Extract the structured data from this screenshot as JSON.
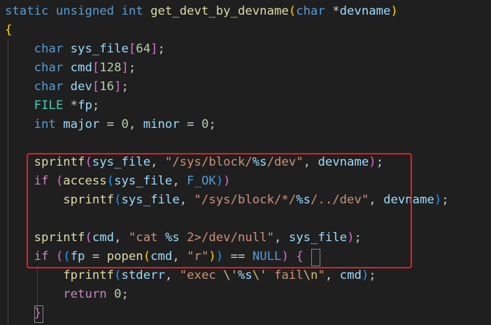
{
  "editor": {
    "theme_colors": {
      "background": "#1f1f1f",
      "keyword": "#569cd6",
      "control_keyword": "#c586c0",
      "function": "#dcdcaa",
      "variable": "#9cdcfe",
      "string": "#ce9178",
      "number": "#b5cea8",
      "type": "#4ec9b0",
      "highlight_box": "#e81e1e"
    },
    "lines": [
      [
        {
          "t": "static unsigned int ",
          "c": "keyword"
        },
        {
          "t": "get_devt_by_devname",
          "c": "func"
        },
        {
          "t": "(",
          "c": "brace1"
        },
        {
          "t": "char ",
          "c": "keyword"
        },
        {
          "t": "*",
          "c": "punc"
        },
        {
          "t": "devname",
          "c": "var"
        },
        {
          "t": ")",
          "c": "brace1"
        }
      ],
      [
        {
          "t": "{",
          "c": "brace1"
        }
      ],
      [
        {
          "t": "    ",
          "c": "punc"
        },
        {
          "t": "char ",
          "c": "keyword"
        },
        {
          "t": "sys_file",
          "c": "var"
        },
        {
          "t": "[",
          "c": "paren2"
        },
        {
          "t": "64",
          "c": "num"
        },
        {
          "t": "]",
          "c": "paren2"
        },
        {
          "t": ";",
          "c": "punc"
        }
      ],
      [
        {
          "t": "    ",
          "c": "punc"
        },
        {
          "t": "char ",
          "c": "keyword"
        },
        {
          "t": "cmd",
          "c": "var"
        },
        {
          "t": "[",
          "c": "paren2"
        },
        {
          "t": "128",
          "c": "num"
        },
        {
          "t": "]",
          "c": "paren2"
        },
        {
          "t": ";",
          "c": "punc"
        }
      ],
      [
        {
          "t": "    ",
          "c": "punc"
        },
        {
          "t": "char ",
          "c": "keyword"
        },
        {
          "t": "dev",
          "c": "var"
        },
        {
          "t": "[",
          "c": "paren2"
        },
        {
          "t": "16",
          "c": "num"
        },
        {
          "t": "]",
          "c": "paren2"
        },
        {
          "t": ";",
          "c": "punc"
        }
      ],
      [
        {
          "t": "    ",
          "c": "punc"
        },
        {
          "t": "FILE ",
          "c": "type"
        },
        {
          "t": "*",
          "c": "punc"
        },
        {
          "t": "fp",
          "c": "var"
        },
        {
          "t": ";",
          "c": "punc"
        }
      ],
      [
        {
          "t": "    ",
          "c": "punc"
        },
        {
          "t": "int ",
          "c": "keyword"
        },
        {
          "t": "major",
          "c": "var"
        },
        {
          "t": " = ",
          "c": "punc"
        },
        {
          "t": "0",
          "c": "num"
        },
        {
          "t": ", ",
          "c": "punc"
        },
        {
          "t": "minor",
          "c": "var"
        },
        {
          "t": " = ",
          "c": "punc"
        },
        {
          "t": "0",
          "c": "num"
        },
        {
          "t": ";",
          "c": "punc"
        }
      ],
      [],
      [
        {
          "t": "    ",
          "c": "punc"
        },
        {
          "t": "sprintf",
          "c": "func"
        },
        {
          "t": "(",
          "c": "paren2"
        },
        {
          "t": "sys_file",
          "c": "var"
        },
        {
          "t": ", ",
          "c": "punc"
        },
        {
          "t": "\"/sys/block/",
          "c": "str"
        },
        {
          "t": "%s",
          "c": "var"
        },
        {
          "t": "/dev\"",
          "c": "str"
        },
        {
          "t": ", ",
          "c": "punc"
        },
        {
          "t": "devname",
          "c": "var"
        },
        {
          "t": ")",
          "c": "paren2"
        },
        {
          "t": ";",
          "c": "punc"
        }
      ],
      [
        {
          "t": "    ",
          "c": "punc"
        },
        {
          "t": "if ",
          "c": "control"
        },
        {
          "t": "(",
          "c": "paren2"
        },
        {
          "t": "access",
          "c": "func"
        },
        {
          "t": "(",
          "c": "paren3"
        },
        {
          "t": "sys_file",
          "c": "var"
        },
        {
          "t": ", ",
          "c": "punc"
        },
        {
          "t": "F_OK",
          "c": "keyword"
        },
        {
          "t": ")",
          "c": "paren3"
        },
        {
          "t": ")",
          "c": "paren2"
        }
      ],
      [
        {
          "t": "        ",
          "c": "punc"
        },
        {
          "t": "sprintf",
          "c": "func"
        },
        {
          "t": "(",
          "c": "paren3"
        },
        {
          "t": "sys_file",
          "c": "var"
        },
        {
          "t": ", ",
          "c": "punc"
        },
        {
          "t": "\"/sys/block/*/",
          "c": "str"
        },
        {
          "t": "%s",
          "c": "var"
        },
        {
          "t": "/../dev\"",
          "c": "str"
        },
        {
          "t": ", ",
          "c": "punc"
        },
        {
          "t": "devname",
          "c": "var"
        },
        {
          "t": ")",
          "c": "paren3"
        },
        {
          "t": ";",
          "c": "punc"
        }
      ],
      [],
      [
        {
          "t": "    ",
          "c": "punc"
        },
        {
          "t": "sprintf",
          "c": "func"
        },
        {
          "t": "(",
          "c": "paren2"
        },
        {
          "t": "cmd",
          "c": "var"
        },
        {
          "t": ", ",
          "c": "punc"
        },
        {
          "t": "\"cat ",
          "c": "str"
        },
        {
          "t": "%s",
          "c": "var"
        },
        {
          "t": " 2>/dev/null\"",
          "c": "str"
        },
        {
          "t": ", ",
          "c": "punc"
        },
        {
          "t": "sys_file",
          "c": "var"
        },
        {
          "t": ")",
          "c": "paren2"
        },
        {
          "t": ";",
          "c": "punc"
        }
      ],
      [
        {
          "t": "    ",
          "c": "punc"
        },
        {
          "t": "if ",
          "c": "control"
        },
        {
          "t": "(",
          "c": "paren2"
        },
        {
          "t": "(",
          "c": "paren3"
        },
        {
          "t": "fp",
          "c": "var"
        },
        {
          "t": " = ",
          "c": "punc"
        },
        {
          "t": "popen",
          "c": "func"
        },
        {
          "t": "(",
          "c": "brace1"
        },
        {
          "t": "cmd",
          "c": "var"
        },
        {
          "t": ", ",
          "c": "punc"
        },
        {
          "t": "\"r\"",
          "c": "str"
        },
        {
          "t": ")",
          "c": "brace1"
        },
        {
          "t": ")",
          "c": "paren3"
        },
        {
          "t": " == ",
          "c": "punc"
        },
        {
          "t": "NULL",
          "c": "keyword"
        },
        {
          "t": ")",
          "c": "paren2"
        },
        {
          "t": " ",
          "c": "punc"
        },
        {
          "t": "{",
          "c": "paren2"
        }
      ],
      [
        {
          "t": "        ",
          "c": "punc"
        },
        {
          "t": "fprintf",
          "c": "func"
        },
        {
          "t": "(",
          "c": "paren3"
        },
        {
          "t": "stderr",
          "c": "var"
        },
        {
          "t": ", ",
          "c": "punc"
        },
        {
          "t": "\"exec ",
          "c": "str"
        },
        {
          "t": "\\'",
          "c": "esc"
        },
        {
          "t": "%s",
          "c": "var"
        },
        {
          "t": "\\'",
          "c": "esc"
        },
        {
          "t": " fail",
          "c": "str"
        },
        {
          "t": "\\n",
          "c": "esc"
        },
        {
          "t": "\"",
          "c": "str"
        },
        {
          "t": ", ",
          "c": "punc"
        },
        {
          "t": "cmd",
          "c": "var"
        },
        {
          "t": ")",
          "c": "paren3"
        },
        {
          "t": ";",
          "c": "punc"
        }
      ],
      [
        {
          "t": "        ",
          "c": "punc"
        },
        {
          "t": "return ",
          "c": "control"
        },
        {
          "t": "0",
          "c": "num"
        },
        {
          "t": ";",
          "c": "punc"
        }
      ],
      [
        {
          "t": "    ",
          "c": "punc"
        },
        {
          "t": "}",
          "c": "paren2"
        }
      ]
    ]
  }
}
